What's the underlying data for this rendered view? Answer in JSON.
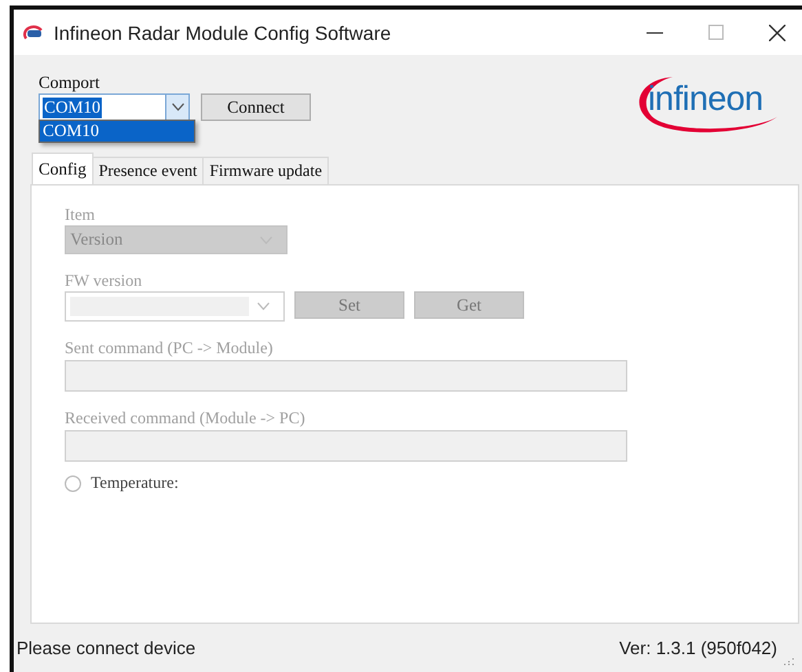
{
  "window": {
    "title": "Infineon Radar Module Config Software"
  },
  "comport": {
    "label": "Comport",
    "value": "COM10",
    "expanded": true,
    "options": [
      {
        "label": "COM10",
        "selected": true
      }
    ]
  },
  "connect_button": "Connect",
  "logo": {
    "text": "infineon"
  },
  "tabs": [
    {
      "label": "Config",
      "selected": true
    },
    {
      "label": "Presence event",
      "selected": false
    },
    {
      "label": "Firmware update",
      "selected": false
    }
  ],
  "config": {
    "disabled": true,
    "item": {
      "label": "Item",
      "value": "Version"
    },
    "fw_version": {
      "label": "FW version"
    },
    "buttons": [
      "Set",
      "Get"
    ],
    "sent_command": {
      "label": "Sent command (PC -> Module)"
    },
    "received_command": {
      "label": "Received command (Module -> PC)"
    },
    "temperature": {
      "label": "Temperature:",
      "selected": false
    }
  },
  "status_bar": {
    "message": "Please connect device",
    "version": "Ver: 1.3.1 (950f042)"
  }
}
